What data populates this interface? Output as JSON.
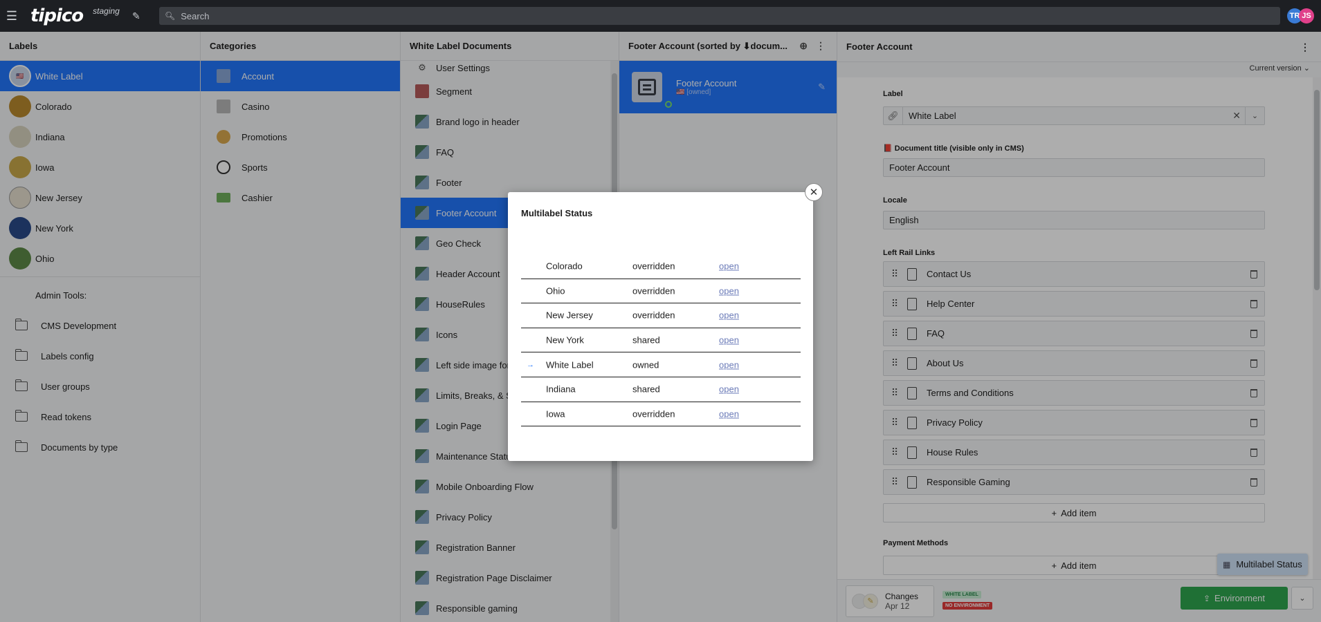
{
  "topbar": {
    "logo": "tipico",
    "environment": "staging",
    "search_placeholder": "Search",
    "avatars": [
      "TR",
      "JS"
    ]
  },
  "labels_pane": {
    "title": "Labels",
    "items": [
      {
        "label": "White Label",
        "selected": true
      },
      {
        "label": "Colorado"
      },
      {
        "label": "Indiana"
      },
      {
        "label": "Iowa"
      },
      {
        "label": "New Jersey"
      },
      {
        "label": "New York"
      },
      {
        "label": "Ohio"
      }
    ],
    "admin_title": "Admin Tools:",
    "admin_items": [
      "CMS Development",
      "Labels config",
      "User groups",
      "Read tokens",
      "Documents by type"
    ]
  },
  "categories_pane": {
    "title": "Categories",
    "items": [
      {
        "label": "Account",
        "icon": "building-icon",
        "selected": true
      },
      {
        "label": "Casino",
        "icon": "slot-icon"
      },
      {
        "label": "Promotions",
        "icon": "money-bag-icon"
      },
      {
        "label": "Sports",
        "icon": "soccer-ball-icon"
      },
      {
        "label": "Cashier",
        "icon": "banknote-icon"
      }
    ]
  },
  "documents_pane": {
    "title": "White Label Documents",
    "items": [
      "User Settings",
      "Segment",
      "Brand logo in header",
      "FAQ",
      "Footer",
      "Footer Account",
      "Geo Check",
      "Header Account",
      "HouseRules",
      "Icons",
      "Left side image for",
      "Limits, Breaks, & Se",
      "Login Page",
      "Maintenance Status for Account",
      "Mobile Onboarding Flow",
      "Privacy Policy",
      "Registration Banner",
      "Registration Page Disclaimer",
      "Responsible gaming"
    ],
    "selected": "Footer Account"
  },
  "footer_list_pane": {
    "title": "Footer Account (sorted by ⬇docum...",
    "item_title": "Footer Account",
    "item_subtitle": "🇺🇸 [owned]"
  },
  "editor": {
    "title": "Footer Account",
    "version": "Current version",
    "label_field": {
      "label": "Label",
      "value": "White Label"
    },
    "doc_title_field": {
      "label": "📕 Document title (visible only in CMS)",
      "value": "Footer Account"
    },
    "locale_field": {
      "label": "Locale",
      "value": "English"
    },
    "left_rail": {
      "label": "Left Rail Links",
      "items": [
        "Contact Us",
        "Help Center",
        "FAQ",
        "About Us",
        "Terms and Conditions",
        "Privacy Policy",
        "House Rules",
        "Responsible Gaming"
      ],
      "add_label": "Add item"
    },
    "payment": {
      "label": "Payment Methods",
      "add_label": "Add item"
    },
    "footer": {
      "changes_label": "Changes",
      "changes_date": "Apr 12",
      "badge_label": "WHITE LABEL",
      "badge_env": "NO ENVIRONMENT",
      "env_button": "Environment",
      "multilabel_tip": "Multilabel Status"
    }
  },
  "modal": {
    "title": "Multilabel Status",
    "rows": [
      {
        "name": "Colorado",
        "status": "overridden",
        "link": "open",
        "current": false
      },
      {
        "name": "Ohio",
        "status": "overridden",
        "link": "open",
        "current": false
      },
      {
        "name": "New Jersey",
        "status": "overridden",
        "link": "open",
        "current": false
      },
      {
        "name": "New York",
        "status": "shared",
        "link": "open",
        "current": false
      },
      {
        "name": "White Label",
        "status": "owned",
        "link": "open",
        "current": true
      },
      {
        "name": "Indiana",
        "status": "shared",
        "link": "open",
        "current": false
      },
      {
        "name": "Iowa",
        "status": "overridden",
        "link": "open",
        "current": false
      }
    ],
    "current_marker": "→"
  },
  "colors": {
    "accent": "#2276fc",
    "topbar": "#1d1f23",
    "environment_button": "#2ea64f",
    "badge_label": "#c7ecd3",
    "badge_env": "#e23b3b"
  }
}
